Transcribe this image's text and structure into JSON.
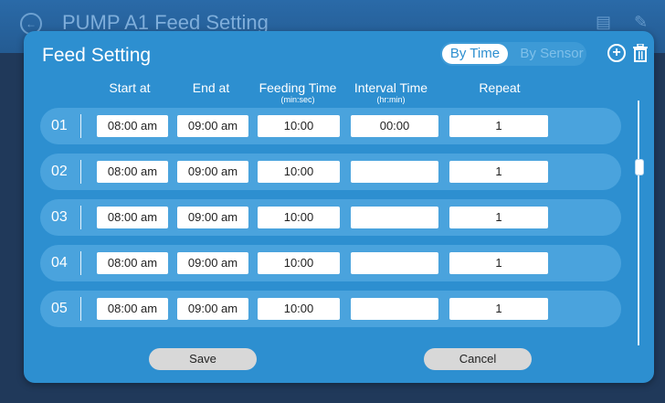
{
  "background": {
    "title": "PUMP A1 Feed Setting",
    "back_icon": "back-arrow-icon",
    "icons": [
      "chart-icon",
      "edit-icon"
    ]
  },
  "modal": {
    "title": "Feed Setting",
    "toggle": {
      "active": "By Time",
      "inactive": "By Sensor"
    },
    "icons": {
      "add": "plus-circle-icon",
      "delete": "trash-icon"
    },
    "columns": {
      "start": "Start at",
      "end": "End at",
      "feeding": "Feeding Time",
      "feeding_unit": "(min:sec)",
      "interval": "Interval Time",
      "interval_unit": "(hr:min)",
      "repeat": "Repeat"
    },
    "rows": [
      {
        "num": "01",
        "start": "08:00 am",
        "end": "09:00 am",
        "feeding": "10:00",
        "interval": "00:00",
        "repeat": "1"
      },
      {
        "num": "02",
        "start": "08:00 am",
        "end": "09:00 am",
        "feeding": "10:00",
        "interval": "",
        "repeat": "1"
      },
      {
        "num": "03",
        "start": "08:00 am",
        "end": "09:00 am",
        "feeding": "10:00",
        "interval": "",
        "repeat": "1"
      },
      {
        "num": "04",
        "start": "08:00 am",
        "end": "09:00 am",
        "feeding": "10:00",
        "interval": "",
        "repeat": "1"
      },
      {
        "num": "05",
        "start": "08:00 am",
        "end": "09:00 am",
        "feeding": "10:00",
        "interval": "",
        "repeat": "1"
      }
    ],
    "buttons": {
      "save": "Save",
      "cancel": "Cancel"
    }
  },
  "colors": {
    "modal": "#2d8fd0",
    "row": "#4aa3dd",
    "background": "#1f3a5a"
  }
}
